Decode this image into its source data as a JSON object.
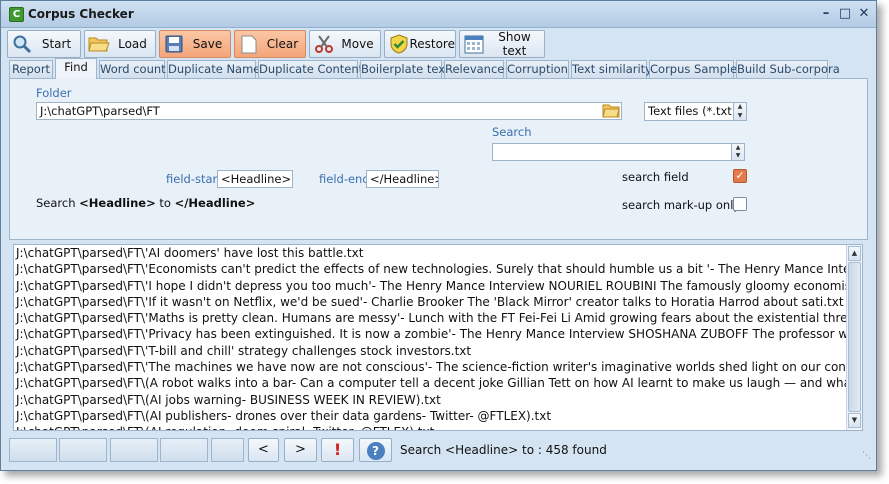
{
  "window": {
    "title": "Corpus Checker"
  },
  "toolbar": {
    "start": "Start",
    "load": "Load",
    "save": "Save",
    "clear": "Clear",
    "move": "Move",
    "restore": "Restore",
    "show_text": "Show text"
  },
  "tabs": [
    "Report",
    "Find",
    "Word count",
    "Duplicate Names",
    "Duplicate Contents",
    "Boilerplate text",
    "Relevance",
    "Corruption",
    "Text similarity",
    "Corpus Sampler",
    "Build Sub-corpora"
  ],
  "active_tab": "Find",
  "find": {
    "folder_label": "Folder",
    "folder_value": "J:\\chatGPT\\parsed\\FT",
    "filetype_value": "Text files (*.txt)",
    "search_label": "Search",
    "search_value": "",
    "field_start_label": "field-start",
    "field_start_value": "<Headline>",
    "field_end_label": "field-end",
    "field_end_value": "</Headline>",
    "summary_prefix": "Search ",
    "summary_start": "<Headline>",
    "summary_mid": " to ",
    "summary_end": "</Headline>",
    "search_field_label": "search field",
    "search_field_checked": true,
    "search_markup_label": "search mark-up only",
    "search_markup_checked": false
  },
  "results": [
    "J:\\chatGPT\\parsed\\FT\\'AI doomers' have lost this battle.txt",
    "J:\\chatGPT\\parsed\\FT\\'Economists can't predict the effects of new technologies. Surely that should humble us a bit '- The Henry Mance Intervi.txt",
    "J:\\chatGPT\\parsed\\FT\\'I hope I didn't depress you too much'- The Henry Mance Interview NOURIEL ROUBINI The famously gloomy economist has",
    "J:\\chatGPT\\parsed\\FT\\'If it wasn't on Netflix, we'd be sued'- Charlie Brooker   The 'Black Mirror' creator talks to Horatia Harrod about sati.txt",
    "J:\\chatGPT\\parsed\\FT\\'Maths is pretty clean. Humans are messy'- Lunch with the FT Fei-Fei Li Amid growing fears about the existential threat.txt",
    "J:\\chatGPT\\parsed\\FT\\'Privacy has been extinguished. It is now a zombie'- The Henry Mance Interview SHOSHANA ZUBOFF The professor who p",
    "J:\\chatGPT\\parsed\\FT\\'T-bill and chill' strategy challenges stock investors.txt",
    "J:\\chatGPT\\parsed\\FT\\'The machines we have now are not conscious'- The science-fiction writer's imaginative worlds shed light on our contempo",
    "J:\\chatGPT\\parsed\\FT\\(A robot walks into a bar- Can a computer tell a decent joke  Gillian Tett on how AI learnt to make us laugh — and what.txt",
    "J:\\chatGPT\\parsed\\FT\\(AI jobs warning- BUSINESS WEEK IN REVIEW).txt",
    "J:\\chatGPT\\parsed\\FT\\(AI publishers- drones over their data gardens- Twitter- @FTLEX).txt",
    "J:\\chatGPT\\parsed\\FT\\(AI regulation- doom spiral- Twitter- @FTLEX).txt"
  ],
  "status": {
    "prev": "<",
    "next": ">",
    "alert": "!",
    "help": "?",
    "message": "Search <Headline> to : 458 found"
  }
}
